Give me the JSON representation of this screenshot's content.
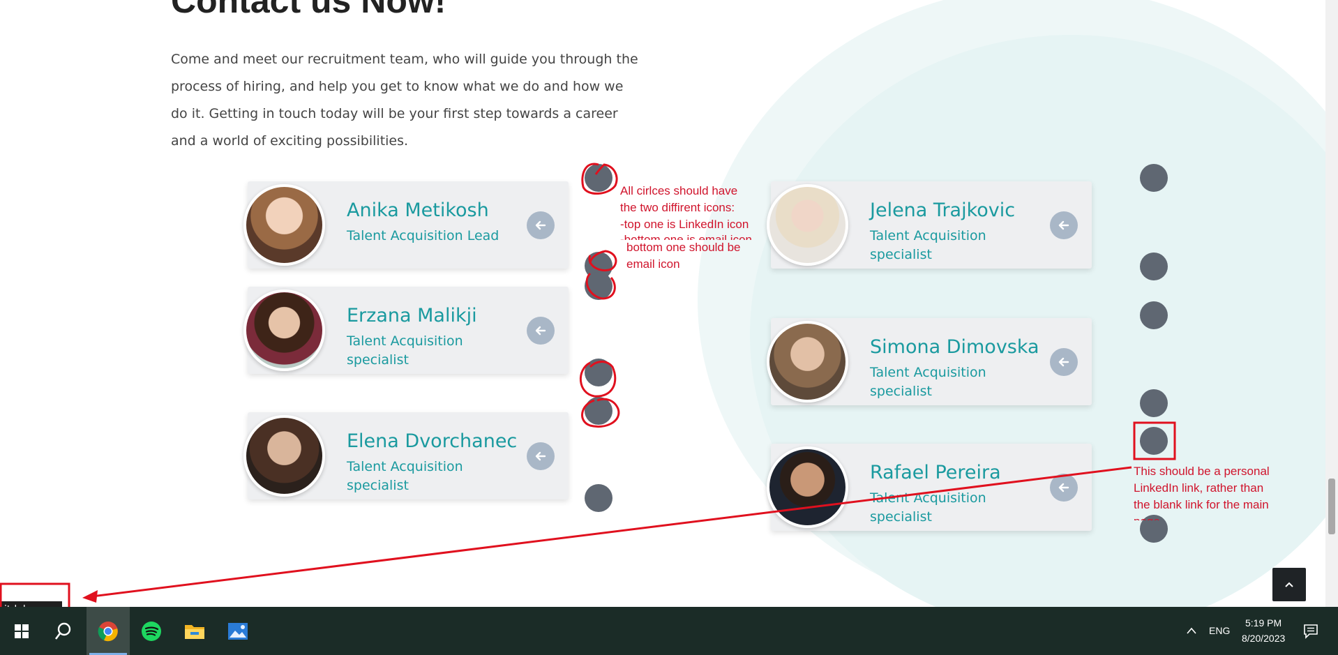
{
  "page": {
    "heading": "Contact us Now!",
    "intro": "Come and meet our recruitment team, who will guide you through the process of hiring, and help you get to know what we do and how we do it. Getting in touch today will be your first step towards a career and a world of exciting possibilities."
  },
  "team": [
    {
      "name": "Anika Metikosh",
      "role": "Talent Acquisition Lead"
    },
    {
      "name": "Erzana Malikji",
      "role": "Talent Acquisition specialist"
    },
    {
      "name": "Elena Dvorchanec",
      "role": "Talent Acquisition specialist"
    },
    {
      "name": "Jelena Trajkovic",
      "role": "Talent Acquisition specialist"
    },
    {
      "name": "Simona Dimovska",
      "role": "Talent Acquisition specialist"
    },
    {
      "name": "Rafael Pereira",
      "role": "Talent Acquisition specialist"
    }
  ],
  "annotations": {
    "note1_l1": "All cirlces should have",
    "note1_l2": "the two diffirent icons:",
    "note1_l3": "-top one is LinkedIn icon",
    "note1_l4": "-bottom one is email icon",
    "note2_l1": "bottom one should be",
    "note2_l2": "email icon",
    "note3_l1": "This should be a personal",
    "note3_l2": "LinkedIn link, rather than",
    "note3_l3": "the blank link for the main",
    "note3_l4": "page"
  },
  "status_bar": {
    "url": "it-labs.com"
  },
  "taskbar": {
    "language": "ENG",
    "time": "5:19 PM",
    "date": "8/20/2023"
  },
  "colors": {
    "accent": "#1a9a9f",
    "annotation": "#e0101e",
    "dot": "#5f6772",
    "taskbar": "#1b2c27"
  },
  "icons": [
    "arrow-left-icon",
    "chevron-up-icon",
    "windows-start-icon",
    "search-icon",
    "chrome-icon",
    "spotify-icon",
    "file-explorer-icon",
    "photos-icon",
    "notification-icon"
  ]
}
